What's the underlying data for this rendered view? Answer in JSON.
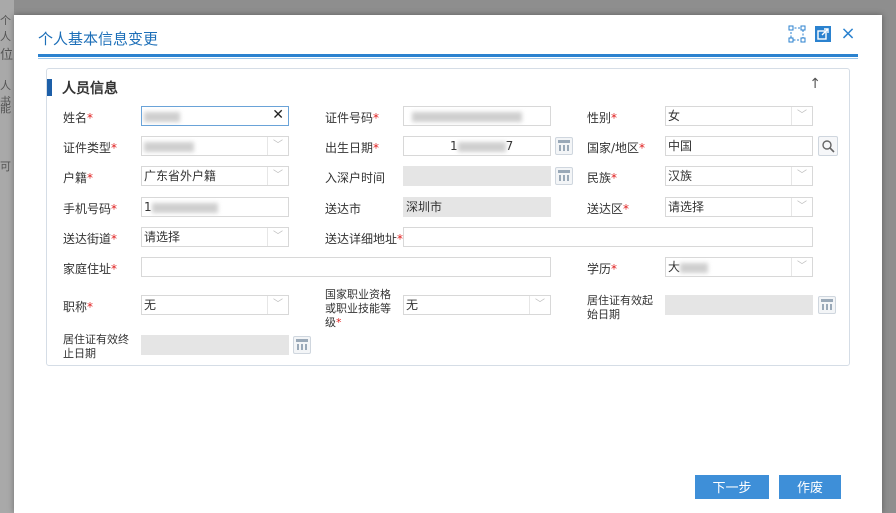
{
  "background": {
    "texts": [
      "个人",
      "位",
      "人书",
      "能",
      "可"
    ]
  },
  "dialog": {
    "title": "个人基本信息变更",
    "icons": [
      "resize-icon",
      "popout-icon",
      "close-icon"
    ],
    "close_glyph": "×"
  },
  "panel": {
    "title": "人员信息",
    "collapse_glyph": "↑"
  },
  "form": {
    "name": {
      "label": "姓名",
      "required": "*"
    },
    "id_no": {
      "label": "证件号码",
      "required": "*"
    },
    "gender": {
      "label": "性别",
      "required": "*",
      "value": "女"
    },
    "id_type": {
      "label": "证件类型",
      "required": "*"
    },
    "birth": {
      "label": "出生日期",
      "required": "*",
      "value_prefix": "1",
      "value_suffix": "7"
    },
    "country": {
      "label": "国家/地区",
      "required": "*",
      "value": "中国"
    },
    "hukou": {
      "label": "户籍",
      "required": "*",
      "value": "广东省外户籍"
    },
    "enter_sz": {
      "label": "入深户时间"
    },
    "ethnic": {
      "label": "民族",
      "required": "*",
      "value": "汉族"
    },
    "phone": {
      "label": "手机号码",
      "required": "*",
      "value_prefix": "1"
    },
    "city": {
      "label": "送达市",
      "value": "深圳市"
    },
    "district": {
      "label": "送达区",
      "required": "*",
      "value": "请选择"
    },
    "street": {
      "label": "送达街道",
      "required": "*",
      "value": "请选择"
    },
    "address": {
      "label": "送达详细地址",
      "required": "*"
    },
    "home": {
      "label": "家庭住址",
      "required": "*"
    },
    "education": {
      "label": "学历",
      "required": "*",
      "value_prefix": "大"
    },
    "title": {
      "label": "职称",
      "required": "*",
      "value": "无"
    },
    "qual": {
      "label_1": "国家职业资格",
      "label_2": "或职业技能等",
      "label_3": "级",
      "required": "*",
      "value": "无"
    },
    "res_start": {
      "label_1": "居住证有效起",
      "label_2": "始日期"
    },
    "res_end": {
      "label_1": "居住证有效终",
      "label_2": "止日期"
    }
  },
  "buttons": {
    "next": "下一步",
    "void": "作废"
  },
  "colors": {
    "accent": "#2b82cf",
    "button": "#3e8fd8",
    "required": "#e02020"
  }
}
